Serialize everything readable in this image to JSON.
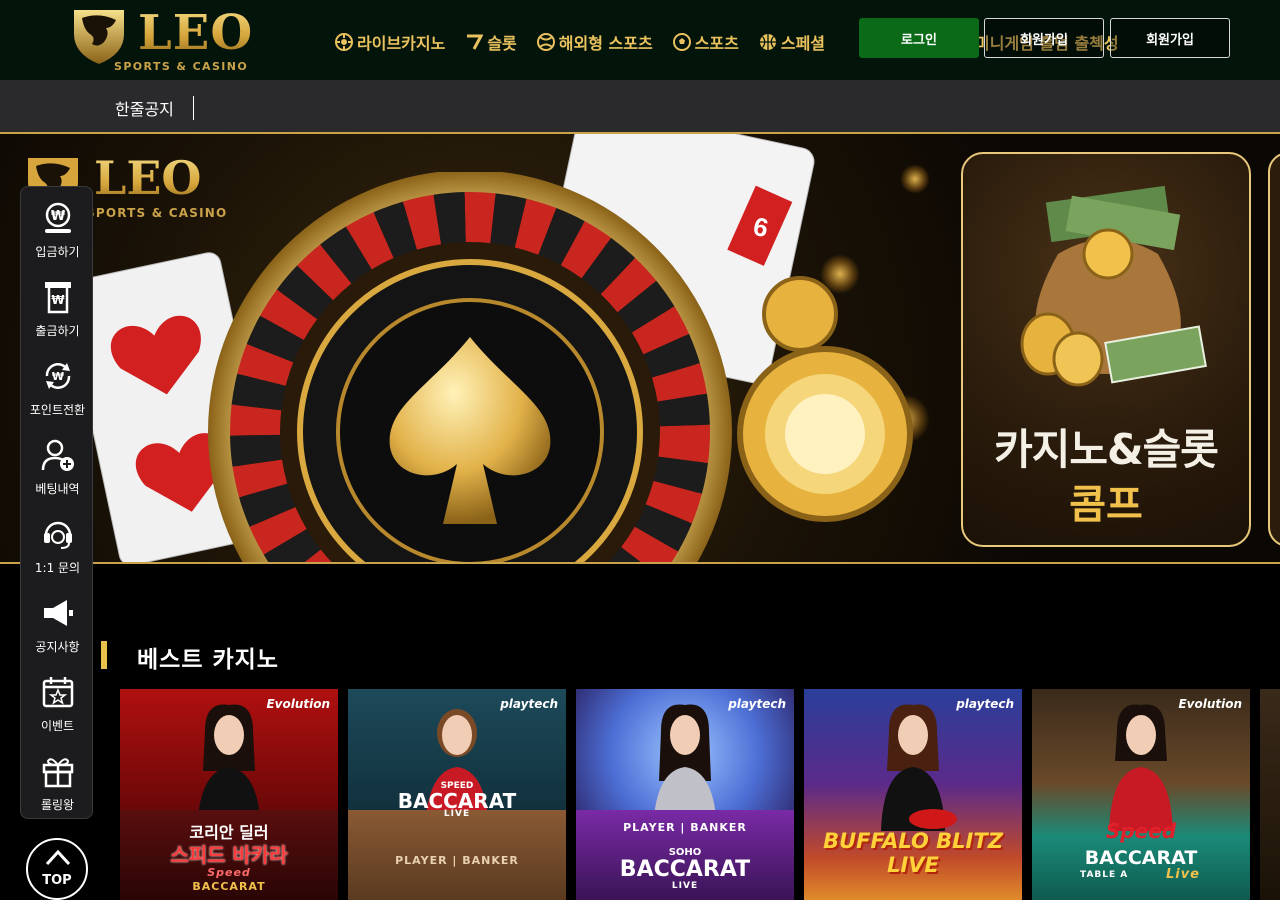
{
  "header": {
    "logo_text": "LEO",
    "logo_sub": "SPORTS & CASINO",
    "nav": [
      {
        "label": "라이브카지노",
        "icon": "roulette-icon"
      },
      {
        "label": "슬롯",
        "icon": "slot-7-icon"
      },
      {
        "label": "해외형 스포츠",
        "icon": "sports-ball-icon"
      },
      {
        "label": "스포츠",
        "icon": "soccer-ball-icon"
      },
      {
        "label": "스페셜",
        "icon": "basketball-icon"
      }
    ],
    "nav_overflow": "미니게임  홀덤  출첵성",
    "login_label": "로그인",
    "join_label": "회원가입",
    "join2_label": "회원가입"
  },
  "notice": {
    "label": "한줄공지"
  },
  "banner": {
    "logo_text": "LEO",
    "logo_sub": "SPORTS & CASINO",
    "card_number": "6",
    "promo_title": "카지노&슬롯",
    "promo_sub": "콤프"
  },
  "side_menu": [
    {
      "label": "입금하기",
      "icon": "deposit-icon"
    },
    {
      "label": "출금하기",
      "icon": "withdraw-icon"
    },
    {
      "label": "포인트전환",
      "icon": "point-exchange-icon"
    },
    {
      "label": "베팅내역",
      "icon": "bet-history-icon"
    },
    {
      "label": "1:1 문의",
      "icon": "support-headset-icon"
    },
    {
      "label": "공지사항",
      "icon": "megaphone-icon"
    },
    {
      "label": "이벤트",
      "icon": "event-calendar-icon"
    },
    {
      "label": "롤링왕",
      "icon": "gift-icon"
    }
  ],
  "top_button": "TOP",
  "section": {
    "title": "베스트 카지노"
  },
  "cards": [
    {
      "provider": "Evolution",
      "title": "코리안 딜러",
      "subtitle": "스피드 바카라",
      "tiny1": "Speed",
      "tiny2": "BACCARAT"
    },
    {
      "provider": "playtech",
      "title": "BACCARAT",
      "subtitle": "SPEED",
      "tiny1": "LIVE",
      "tiny2": "PLAYER | BANKER"
    },
    {
      "provider": "playtech",
      "title": "BACCARAT",
      "subtitle": "SOHO",
      "tiny1": "PLAYER | BANKER",
      "tiny2": "LIVE"
    },
    {
      "provider": "playtech",
      "title": "BUFFALO BLITZ",
      "subtitle": "LIVE",
      "tiny1": "",
      "tiny2": ""
    },
    {
      "provider": "Evolution",
      "title": "BACCARAT",
      "subtitle": "Speed",
      "tiny1": "TABLE A",
      "tiny2": "Live"
    }
  ],
  "colors": {
    "gold": "#e9c15e",
    "login_green": "#0a6a17",
    "section_accent": "#e8c24a",
    "header_bg": "#03150a",
    "notice_bg": "#2a2a2c"
  }
}
